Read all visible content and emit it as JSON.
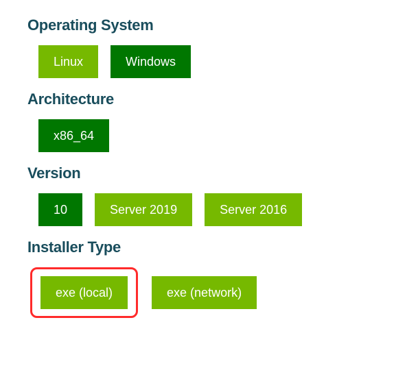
{
  "sections": {
    "os": {
      "title": "Operating System",
      "options": [
        {
          "label": "Linux",
          "variant": "light"
        },
        {
          "label": "Windows",
          "variant": "dark"
        }
      ]
    },
    "arch": {
      "title": "Architecture",
      "options": [
        {
          "label": "x86_64",
          "variant": "dark"
        }
      ]
    },
    "version": {
      "title": "Version",
      "options": [
        {
          "label": "10",
          "variant": "dark"
        },
        {
          "label": "Server 2019",
          "variant": "light"
        },
        {
          "label": "Server 2016",
          "variant": "light"
        }
      ]
    },
    "installer": {
      "title": "Installer Type",
      "options": [
        {
          "label": "exe (local)",
          "variant": "light",
          "highlighted": true
        },
        {
          "label": "exe (network)",
          "variant": "light",
          "highlighted": false
        }
      ]
    }
  }
}
